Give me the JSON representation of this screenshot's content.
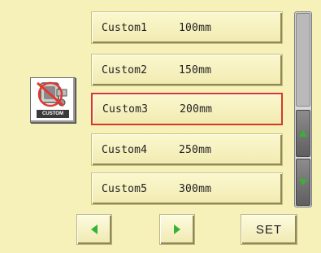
{
  "items": [
    {
      "name": "Custom1",
      "value": "100mm",
      "selected": false
    },
    {
      "name": "Custom2",
      "value": "150mm",
      "selected": false
    },
    {
      "name": "Custom3",
      "value": "200mm",
      "selected": true
    },
    {
      "name": "Custom4",
      "value": "250mm",
      "selected": false
    },
    {
      "name": "Custom5",
      "value": "300mm",
      "selected": false
    }
  ],
  "custom_icon": {
    "label": "CUSTOM",
    "icon": "custom-hoop-icon"
  },
  "buttons": {
    "set_label": "SET"
  },
  "colors": {
    "background": "#f6f1b8",
    "selection_border": "#d33a2c",
    "arrow_green": "#35b334"
  }
}
